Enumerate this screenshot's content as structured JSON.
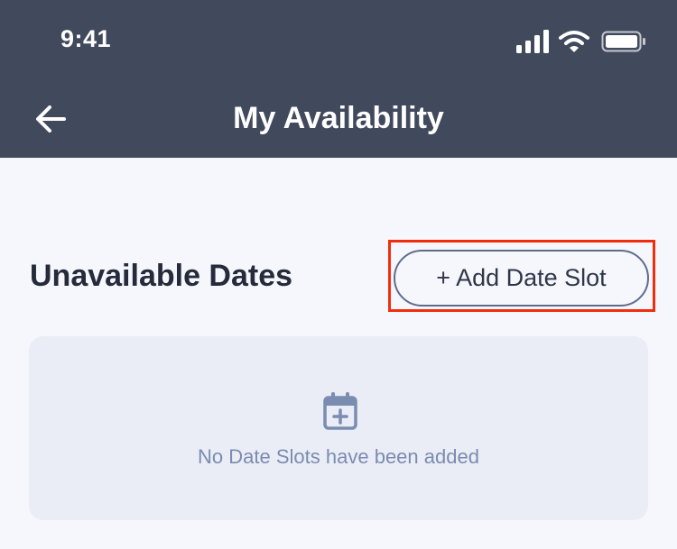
{
  "status_bar": {
    "time": "9:41"
  },
  "header": {
    "title": "My Availability"
  },
  "section": {
    "title": "Unavailable Dates",
    "add_button_label": "+ Add Date Slot"
  },
  "empty_state": {
    "message": "No Date Slots have been added"
  },
  "icons": {
    "back": "arrow-left-icon",
    "calendar": "calendar-plus-icon",
    "signal": "signal-icon",
    "wifi": "wifi-icon",
    "battery": "battery-icon"
  },
  "colors": {
    "header_bg": "#41495c",
    "page_bg": "#f5f7fd",
    "highlight": "#f02e0e",
    "muted_text": "#7a8cb0"
  }
}
